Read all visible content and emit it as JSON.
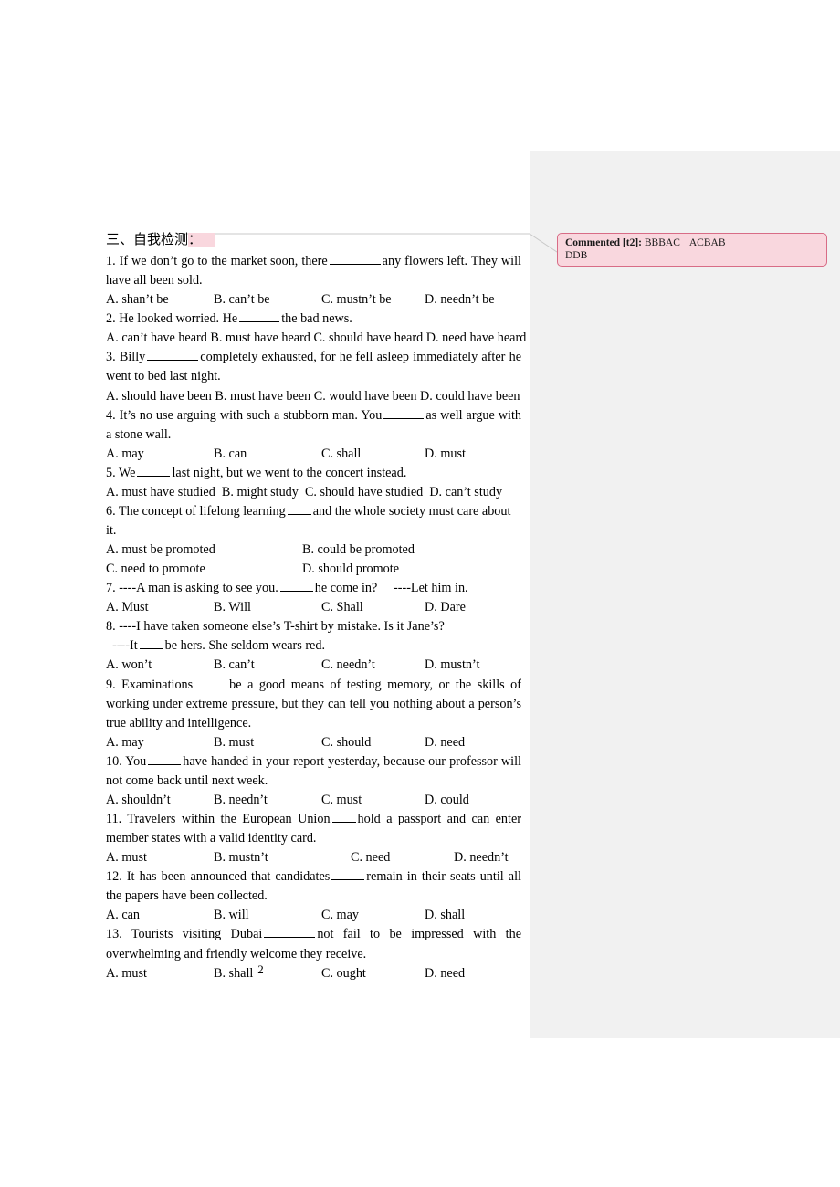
{
  "document": {
    "heading": {
      "text": "三、自我检测",
      "highlighted_colon": "："
    },
    "page_number": "2",
    "questions": [
      {
        "id": "q1",
        "stem_before": "1. If we don’t go to the market soon, there",
        "stem_after": "any flowers left. They will have all been sold.",
        "blank": "b-l",
        "options": [
          "A. shan’t be",
          "B. can’t be",
          "C. mustn’t be",
          "D. needn’t be"
        ],
        "layout": "four-col"
      },
      {
        "id": "q2",
        "stem_before": "2. He looked worried. He",
        "stem_after": "the bad news.",
        "blank": "b-m",
        "options": [
          "A. can’t have heard",
          "B. must have heard",
          "C. should have heard",
          "D. need have heard"
        ],
        "layout": "run-in"
      },
      {
        "id": "q3",
        "stem_before": "3. Billy",
        "stem_after": "completely exhausted, for he fell asleep immediately after he went to bed last night.",
        "blank": "b-l",
        "options": [
          "A. should have been",
          "B. must have been",
          "C. would have been",
          "D. could have been"
        ],
        "layout": "run-in"
      },
      {
        "id": "q4",
        "stem_before": "4. It’s no use arguing with such a stubborn man. You",
        "stem_after": "as well argue with a stone wall.",
        "blank": "b-m",
        "options": [
          "A. may",
          "B. can",
          "C. shall",
          "D. must"
        ],
        "layout": "four-col"
      },
      {
        "id": "q5",
        "stem_before": "5. We",
        "stem_after": "last night, but we went to the concert instead.",
        "blank": "b-s",
        "options": [
          "A. must have studied",
          "B. might study",
          "C. should have studied",
          "D. can’t study"
        ],
        "layout": "run-in"
      },
      {
        "id": "q6",
        "stem_before": "6. The concept of lifelong learning",
        "stem_after": "and the whole society must care about it.",
        "blank": "b-xs",
        "options": [
          "A. must be promoted",
          "B. could be promoted",
          "C. need to promote",
          "D. should promote"
        ],
        "layout": "two-col"
      },
      {
        "id": "q7",
        "stem_before": "7. ----A man is asking to see you.",
        "stem_after": "he come in?",
        "stem_tail": "----Let him in.",
        "blank": "b-s",
        "options": [
          "A. Must",
          "B. Will",
          "C. Shall",
          "D. Dare"
        ],
        "layout": "four-col"
      },
      {
        "id": "q8",
        "stem_line1": "8. ----I have taken someone else’s T-shirt by mistake. Is it Jane’s?",
        "stem_before": "----It",
        "stem_after": "be hers. She seldom wears red.",
        "blank": "b-xs",
        "options": [
          "A. won’t",
          "B. can’t",
          "C. needn’t",
          "D. mustn’t"
        ],
        "layout": "four-col"
      },
      {
        "id": "q9",
        "stem_before": "9. Examinations",
        "stem_after": "be a good means of testing memory, or the skills of working under extreme pressure, but they can tell you nothing about a person’s true ability and intelligence.",
        "blank": "b-s",
        "options": [
          "A. may",
          "B. must",
          "C. should",
          "D. need"
        ],
        "layout": "four-col"
      },
      {
        "id": "q10",
        "stem_before": "10. You",
        "stem_after": "have handed in your report yesterday, because our professor will not come back until next week.",
        "blank": "b-s",
        "options": [
          "A. shouldn’t",
          "B. needn’t",
          "C. must",
          "D. could"
        ],
        "layout": "four-col"
      },
      {
        "id": "q11",
        "stem_before": "11. Travelers within the European Union",
        "stem_after": "hold a passport and can enter member states with a valid identity card.",
        "blank": "b-xs",
        "options": [
          "A. must",
          "B. mustn’t",
          "C. need",
          "D. needn’t"
        ],
        "layout": "four-col"
      },
      {
        "id": "q12",
        "stem_before": "12. It has been announced that candidates",
        "stem_after": "remain in their seats until all the papers have been collected.",
        "blank": "b-s",
        "options": [
          "A. can",
          "B. will",
          "C. may",
          "D. shall"
        ],
        "layout": "four-col"
      },
      {
        "id": "q13",
        "stem_before": "13. Tourists visiting Dubai",
        "stem_after": "not fail to be impressed with the overwhelming and friendly welcome they receive.",
        "blank": "b-l",
        "options": [
          "A. must",
          "B. shall",
          "C. ought",
          "D. need"
        ],
        "layout": "four-col"
      }
    ]
  },
  "comment": {
    "label": "Commented [t2]:",
    "body_line1_a": "BBBAC",
    "body_line1_b": "ACBAB",
    "body_line2": "DDB",
    "balloon_bg": "#f9d7de",
    "balloon_border": "#d86c86",
    "gutter_bg": "#f1f1f1",
    "highlight_color": "#f9d7de"
  }
}
